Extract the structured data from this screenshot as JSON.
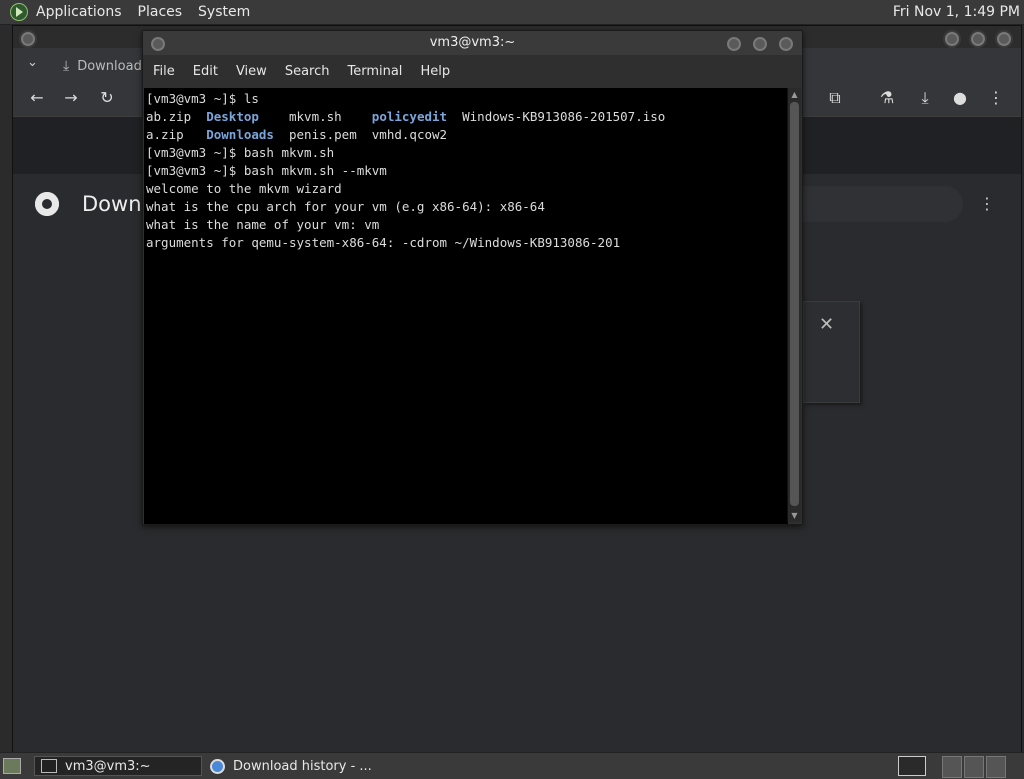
{
  "top_panel": {
    "menus": [
      "Applications",
      "Places",
      "System"
    ],
    "clock": "Fri Nov 1,  1:49 PM"
  },
  "browser": {
    "tab_title": "Download",
    "page_title": "Downl",
    "icons": {
      "back": "arrow-left",
      "forward": "arrow-right",
      "reload": "reload",
      "extensions": "puzzle",
      "labs": "flask",
      "download": "download",
      "profile": "profile",
      "menu": "kebab"
    }
  },
  "terminal": {
    "title": "vm3@vm3:~",
    "menus": [
      "File",
      "Edit",
      "View",
      "Search",
      "Terminal",
      "Help"
    ],
    "lines": [
      {
        "segments": [
          {
            "text": "[vm3@vm3 ~]$ ls",
            "style": "normal"
          }
        ]
      },
      {
        "segments": [
          {
            "text": "ab.zip  ",
            "style": "normal"
          },
          {
            "text": "Desktop",
            "style": "dir"
          },
          {
            "text": "    mkvm.sh    ",
            "style": "normal"
          },
          {
            "text": "policyedit",
            "style": "dir"
          },
          {
            "text": "  Windows-KB913086-201507.iso",
            "style": "normal"
          }
        ]
      },
      {
        "segments": [
          {
            "text": "a.zip   ",
            "style": "normal"
          },
          {
            "text": "Downloads",
            "style": "dir"
          },
          {
            "text": "  penis.pem  vmhd.qcow2",
            "style": "normal"
          }
        ]
      },
      {
        "segments": [
          {
            "text": "[vm3@vm3 ~]$ bash mkvm.sh",
            "style": "normal"
          }
        ]
      },
      {
        "segments": [
          {
            "text": "[vm3@vm3 ~]$ bash mkvm.sh --mkvm",
            "style": "normal"
          }
        ]
      },
      {
        "segments": [
          {
            "text": "welcome to the mkvm wizard",
            "style": "normal"
          }
        ]
      },
      {
        "segments": [
          {
            "text": "what is the cpu arch for your vm (e.g x86-64): x86-64",
            "style": "normal"
          }
        ]
      },
      {
        "segments": [
          {
            "text": "what is the name of your vm: vm",
            "style": "normal"
          }
        ]
      },
      {
        "segments": [
          {
            "text": "arguments for qemu-system-x86-64: -cdrom ~/Windows-KB913086-201",
            "style": "normal"
          }
        ]
      }
    ]
  },
  "taskbar": {
    "items": [
      {
        "label": "vm3@vm3:~",
        "icon": "terminal-icon",
        "active": true
      },
      {
        "label": "Download history - ...",
        "icon": "chrome-icon",
        "active": false
      }
    ]
  }
}
